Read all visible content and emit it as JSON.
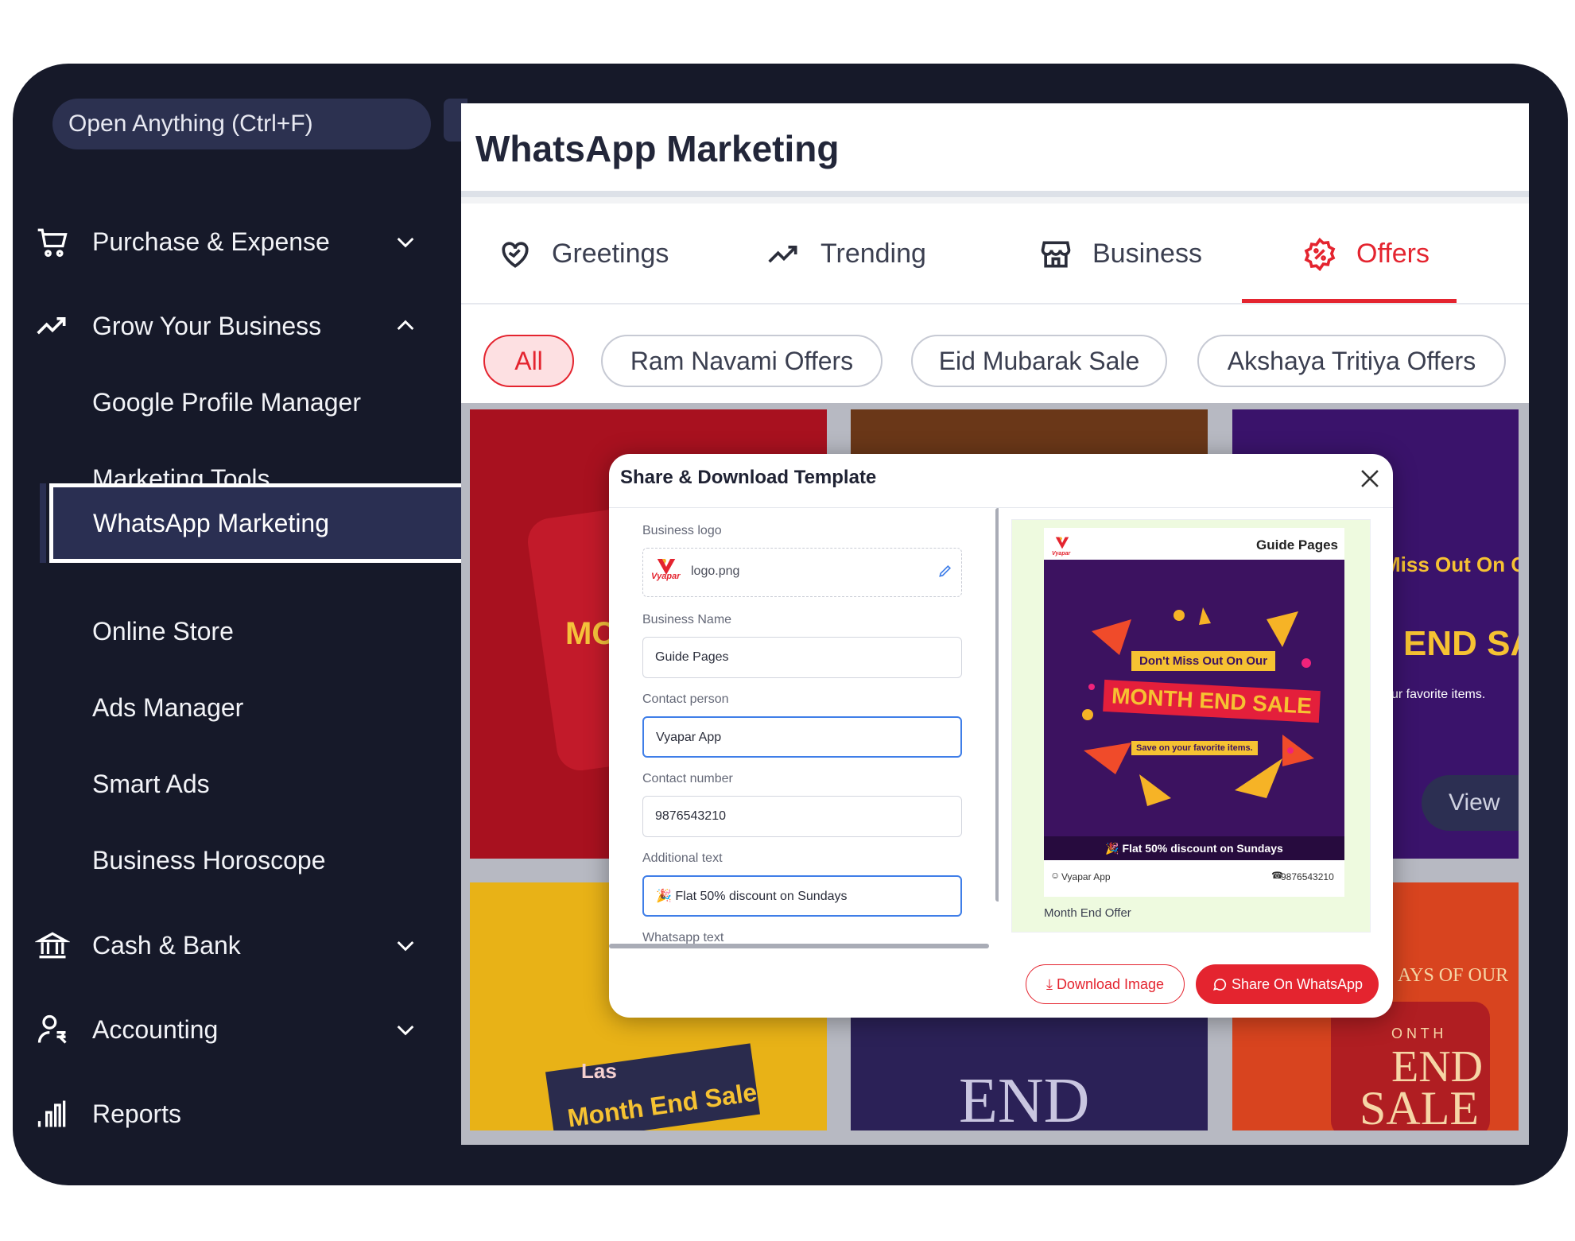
{
  "sidebar": {
    "search_placeholder": "Open Anything (Ctrl+F)",
    "items": [
      {
        "label": "Purchase & Expense",
        "icon": "cart-icon",
        "expanded": false
      },
      {
        "label": "Grow Your Business",
        "icon": "trending-up-icon",
        "expanded": true
      },
      {
        "label": "Cash & Bank",
        "icon": "bank-icon",
        "expanded": false
      },
      {
        "label": "Accounting",
        "icon": "user-rupee-icon",
        "expanded": false
      },
      {
        "label": "Reports",
        "icon": "bar-chart-icon"
      }
    ],
    "grow_sub_items": [
      "Google Profile Manager",
      "Marketing Tools",
      "WhatsApp Marketing",
      "Online Store",
      "Ads Manager",
      "Smart Ads",
      "Business Horoscope"
    ]
  },
  "main": {
    "title": "WhatsApp Marketing",
    "tabs": [
      {
        "label": "Greetings",
        "icon": "heart-handshake-icon"
      },
      {
        "label": "Trending",
        "icon": "trending-up-icon"
      },
      {
        "label": "Business",
        "icon": "store-icon"
      },
      {
        "label": "Offers",
        "icon": "discount-badge-icon",
        "active": true
      }
    ],
    "chips": [
      "All",
      "Ram Navami Offers",
      "Eid Mubarak Sale",
      "Akshaya Tritiya Offers"
    ],
    "cards": [
      {
        "text": "MO S"
      },
      {
        "text": ""
      },
      {
        "text": "Miss Out On Our",
        "text2": "END SALE",
        "text3": "ur favorite items.",
        "button": "View"
      },
      {
        "text": "Las",
        "text2": "Month End Sale"
      },
      {
        "text": "END"
      },
      {
        "text": "AYS OF OUR",
        "text2": "O N T H",
        "text3": "END",
        "text4": "SALE"
      }
    ]
  },
  "modal": {
    "title": "Share & Download Template",
    "fields": {
      "logo_label": "Business logo",
      "logo_file": "logo.png",
      "logo_brand": "Vyapar",
      "name_label": "Business Name",
      "name_value": "Guide Pages",
      "contact_label": "Contact person",
      "contact_value": "Vyapar App",
      "number_label": "Contact number",
      "number_value": "9876543210",
      "additional_label": "Additional text",
      "additional_value": "🎉 Flat 50% discount on Sundays",
      "whatsapp_label": "Whatsapp text"
    },
    "preview": {
      "business": "Guide Pages",
      "brand": "Vyapar",
      "poster_line1": "Don't Miss Out On Our",
      "poster_line2": "MONTH END SALE",
      "poster_line3": "Save on your favorite items.",
      "band": "🎉 Flat 50% discount on Sundays",
      "contact": "Vyapar App",
      "number": "9876543210",
      "caption": "Month End Offer"
    },
    "buttons": {
      "download": "Download Image",
      "share": "Share On WhatsApp"
    }
  },
  "colors": {
    "accent": "#e4242f",
    "sidebar_bg": "#161929",
    "active_bg": "#2a2f52",
    "focus": "#3f7ee8"
  }
}
